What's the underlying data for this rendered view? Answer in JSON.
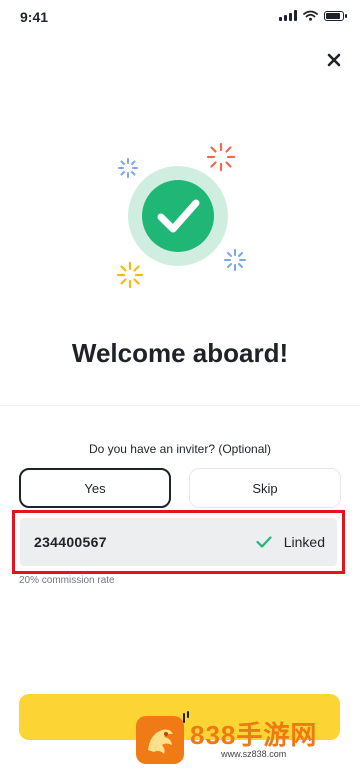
{
  "status_bar": {
    "time": "9:41"
  },
  "welcome": {
    "title": "Welcome aboard!"
  },
  "inviter": {
    "question": "Do you have an inviter? (Optional)",
    "yes_label": "Yes",
    "skip_label": "Skip",
    "code": "234400567",
    "status": "Linked",
    "commission": "20% commission rate"
  },
  "watermark": {
    "brand": "838手游网",
    "site": "www.sz838.com"
  },
  "colors": {
    "accent_yellow": "#FCD535",
    "success_green": "#1FB676",
    "highlight_red": "#E0161D",
    "text_dark": "#1E2329"
  }
}
